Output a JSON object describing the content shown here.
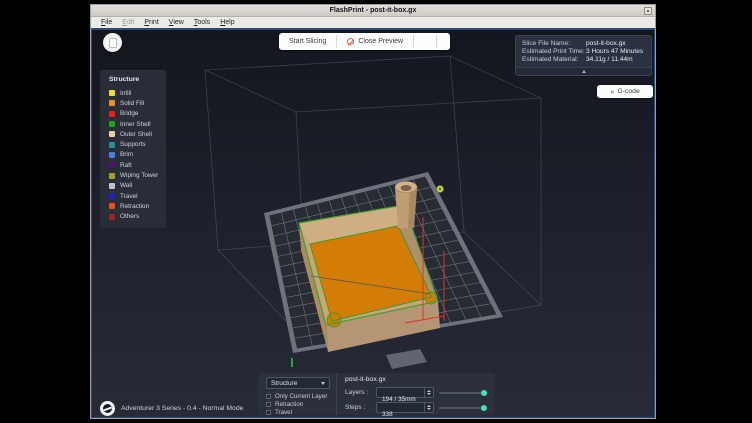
{
  "window": {
    "title": "FlashPrint - post-it-box.gx"
  },
  "menu_bar": {
    "items": [
      {
        "label": "File",
        "enabled": true
      },
      {
        "label": "Edit",
        "enabled": false
      },
      {
        "label": "Print",
        "enabled": true
      },
      {
        "label": "View",
        "enabled": true
      },
      {
        "label": "Tools",
        "enabled": true
      },
      {
        "label": "Help",
        "enabled": true
      }
    ]
  },
  "toolbar": {
    "start_slicing_label": "Start Slicing",
    "close_preview_label": "Close Preview"
  },
  "slice_info": {
    "rows": [
      {
        "label": "Slice File Name:",
        "value": "post-it-box.gx"
      },
      {
        "label": "Estimated Print Time:",
        "value": "3 Hours 47 Minutes"
      },
      {
        "label": "Estimated Material:",
        "value": "34.11g / 11.44m"
      }
    ]
  },
  "gcode_button": {
    "label": "G-code"
  },
  "legend": {
    "title": "Structure",
    "items": [
      {
        "label": "Infill",
        "color": "#f0e11c"
      },
      {
        "label": "Solid Fill",
        "color": "#ef8f1c"
      },
      {
        "label": "Bridge",
        "color": "#e81c1c"
      },
      {
        "label": "Inner Shell",
        "color": "#1ca81c"
      },
      {
        "label": "Outer Shell",
        "color": "#f2c9a0"
      },
      {
        "label": "Supports",
        "color": "#2a8f8f"
      },
      {
        "label": "Brim",
        "color": "#4d7ce8"
      },
      {
        "label": "Raft",
        "color": "#55107a"
      },
      {
        "label": "Wiping Tower",
        "color": "#a89a35"
      },
      {
        "label": "Wall",
        "color": "#bfc3c7"
      },
      {
        "label": "Travel",
        "color": "#2222bb"
      },
      {
        "label": "Retraction",
        "color": "#ef4d1c"
      },
      {
        "label": "Others",
        "color": "#9e2424"
      }
    ]
  },
  "preview_controls": {
    "structure_dropdown_value": "Structure",
    "checkboxes": [
      {
        "label": "Only Current Layer",
        "checked": false
      },
      {
        "label": "Retraction",
        "checked": false
      },
      {
        "label": "Travel",
        "checked": false
      }
    ],
    "file_name": "post-it-box.gx",
    "layers": {
      "label": "Layers :",
      "value": "194 / 35mm"
    },
    "steps": {
      "label": "Steps :",
      "value": "338"
    },
    "slider_color": "#3fe2bd"
  },
  "status_bar": {
    "machine_info": "Adventurer 3 Series - 0.4 - Normal Mode"
  }
}
